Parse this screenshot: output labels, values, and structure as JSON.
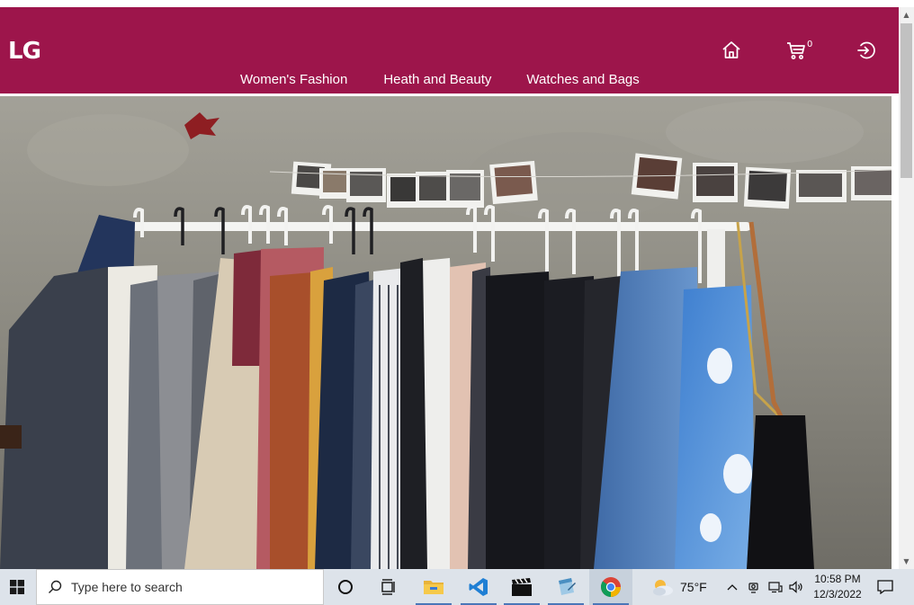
{
  "header": {
    "logo": "LG",
    "cart_count": "0",
    "brand_color": "#9d154b",
    "icons": [
      "home-icon",
      "cart-icon",
      "logout-icon"
    ]
  },
  "nav": {
    "items": [
      {
        "label": "Women's Fashion"
      },
      {
        "label": "Heath and Beauty"
      },
      {
        "label": "Watches and Bags"
      }
    ]
  },
  "hero": {
    "image": "clothes-rack-photo"
  },
  "taskbar": {
    "search_placeholder": "Type here to search",
    "temperature": "75°F",
    "time": "10:58 PM",
    "date": "12/3/2022",
    "apps": [
      "task-view-icon",
      "file-explorer-icon",
      "vscode-icon",
      "video-editor-icon",
      "notepad-icon",
      "chrome-icon"
    ],
    "bg_color": "#dde3ea"
  }
}
